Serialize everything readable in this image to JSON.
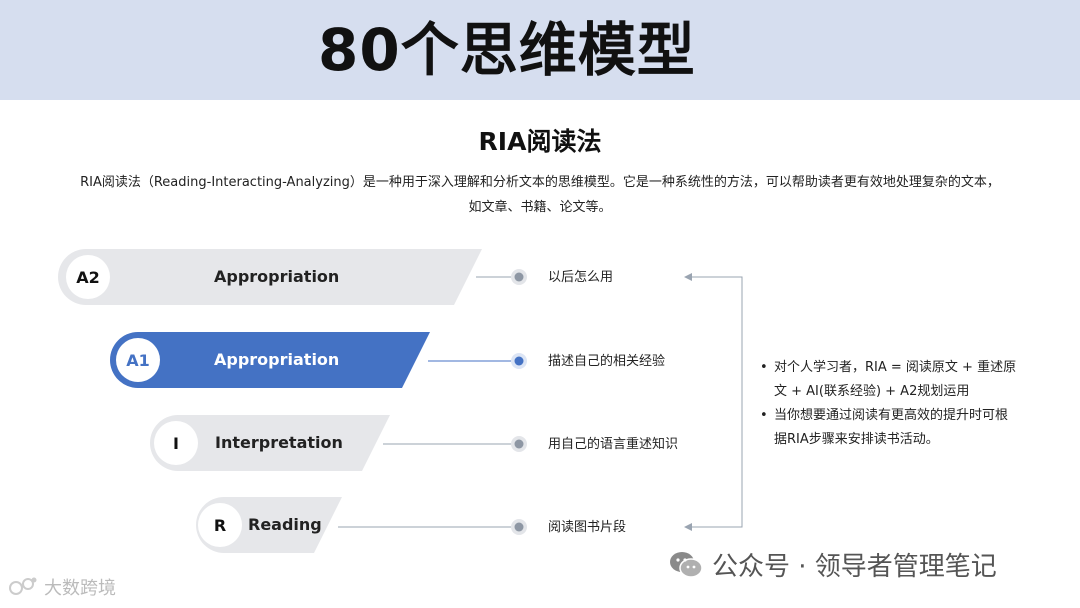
{
  "header": {
    "title": "80个思维模型",
    "band_color": "#d6deef"
  },
  "section": {
    "title": "RIA阅读法",
    "intro_line1": "RIA阅读法（Reading-Interacting-Analyzing）是一种用于深入理解和分析文本的思维模型。它是一种系统性的方法，可以帮助读者更有效地处理复杂的文本，",
    "intro_line2": "如文章、书籍、论文等。"
  },
  "steps": [
    {
      "badge": "A2",
      "label": "Appropriation",
      "desc": "以后怎么用",
      "active": false
    },
    {
      "badge": "A1",
      "label": "Appropriation",
      "desc": "描述自己的相关经验",
      "active": true
    },
    {
      "badge": "I",
      "label": "Interpretation",
      "desc": "用自己的语言重述知识",
      "active": false
    },
    {
      "badge": "R",
      "label": "Reading",
      "desc": "阅读图书片段",
      "active": false
    }
  ],
  "notes": [
    "对个人学习者，RIA = 阅读原文 + 重述原文 + AI(联系经验) + A2规划运用",
    "当你想要通过阅读有更高效的提升时可根据RIA步骤来安排读书活动。"
  ],
  "footer": {
    "text": "公众号 · 领导者管理笔记",
    "icon": "wechat-icon"
  },
  "watermark": {
    "text": "大数跨境"
  },
  "colors": {
    "accent": "#4472c4",
    "shape_gray": "#e6e7ea",
    "connector": "#9aa4b1"
  }
}
